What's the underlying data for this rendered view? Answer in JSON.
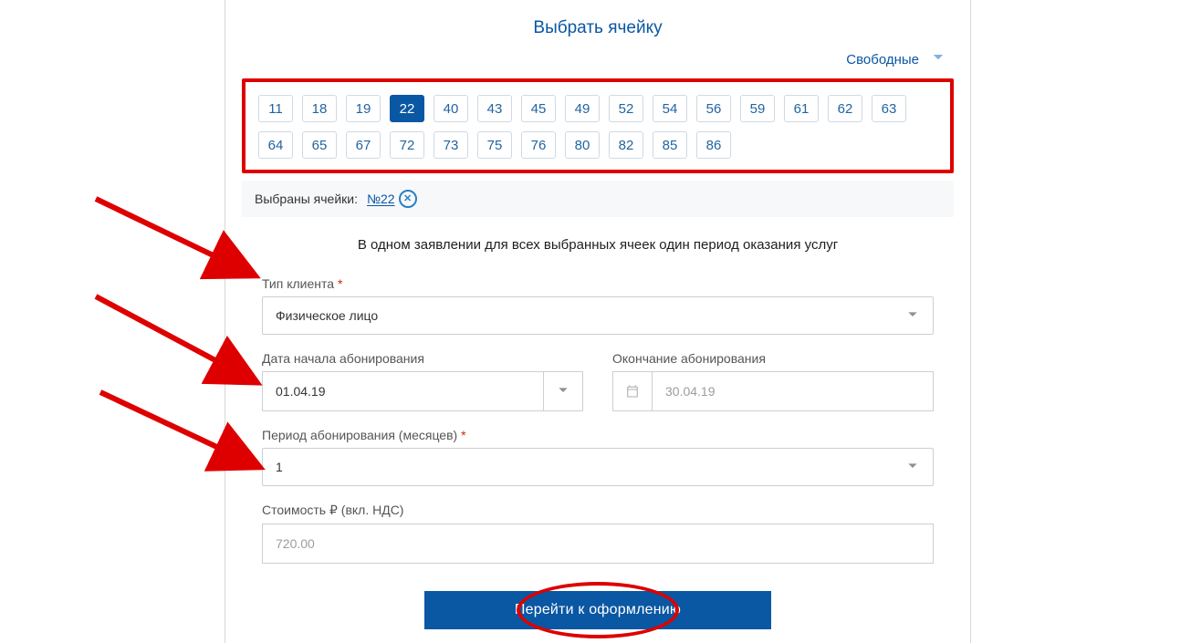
{
  "title": "Выбрать ячейку",
  "free_toggle_label": "Свободные",
  "cells_row1": [
    "11",
    "18",
    "19",
    "22",
    "40",
    "43",
    "45",
    "49",
    "52",
    "54",
    "56",
    "59",
    "61",
    "62",
    "63",
    "64"
  ],
  "cells_row2": [
    "65",
    "67",
    "72",
    "73",
    "75",
    "76",
    "80",
    "82",
    "85",
    "86"
  ],
  "selected_cell_value": "22",
  "selected_label": "Выбраны ячейки:",
  "selected_value_display": "№22",
  "info_line": "В одном заявлении для всех выбранных ячеек один период оказания услуг",
  "field_client_type_label": "Тип клиента",
  "field_client_type_value": "Физическое лицо",
  "field_start_label": "Дата начала абонирования",
  "field_start_value": "01.04.19",
  "field_end_label": "Окончание абонирования",
  "field_end_value": "30.04.19",
  "field_period_label": "Период абонирования (месяцев)",
  "field_period_value": "1",
  "field_cost_label": "Стоимость ₽ (вкл. НДС)",
  "field_cost_value": "720.00",
  "submit_label": "Перейти к оформлению",
  "required_mark": "*"
}
